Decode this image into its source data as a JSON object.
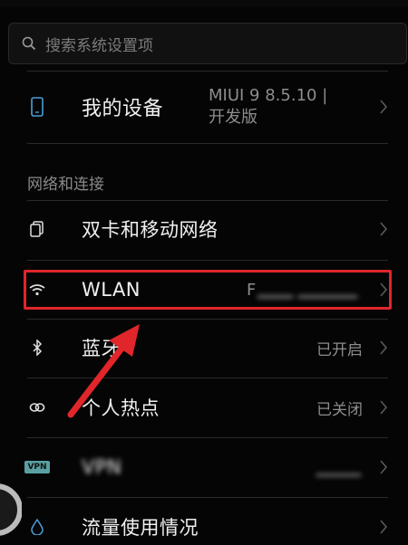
{
  "search": {
    "placeholder": "搜索系统设置项",
    "icon": "search-icon"
  },
  "device": {
    "label": "我的设备",
    "value_line1": "MIUI 9 8.5.10 |",
    "value_line2": "开发版",
    "icon": "phone-icon"
  },
  "section": {
    "title": "网络和连接"
  },
  "items": [
    {
      "label": "双卡和移动网络",
      "value": "",
      "icon": "sim-card-icon"
    },
    {
      "label": "WLAN",
      "value": "F",
      "icon": "wifi-icon"
    },
    {
      "label": "蓝牙",
      "value": "已开启",
      "icon": "bluetooth-icon"
    },
    {
      "label": "个人热点",
      "value": "已关闭",
      "icon": "hotspot-icon"
    },
    {
      "label": "VPN",
      "value": "",
      "icon": "vpn-icon",
      "badge": "VPN"
    },
    {
      "label": "流量使用情况",
      "value": "",
      "icon": "data-usage-icon"
    }
  ],
  "colors": {
    "highlight": "#e0262b",
    "accent_icon": "#4a9fd8",
    "vpn_badge": "#5aa0a0"
  }
}
